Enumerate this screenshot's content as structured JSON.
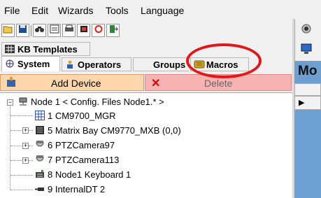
{
  "menu": [
    "File",
    "Edit",
    "Wizards",
    "Tools",
    "Language"
  ],
  "toolbar_icons": [
    "open-folder-icon",
    "save-icon",
    "find-icon",
    "properties-icon",
    "print-icon",
    "sync-icon",
    "refresh-icon",
    "exit-icon"
  ],
  "tabs": {
    "kb_templates": "KB Templates",
    "system": "System",
    "operators": "Operators",
    "groups": "Groups",
    "macros": "Macros"
  },
  "actions": {
    "add_device": "Add Device",
    "delete": "Delete"
  },
  "tree": {
    "root": "Node 1 < Config. Files Node1.* >",
    "items": [
      {
        "label": "1 CM9700_MGR",
        "icon": "grid-icon",
        "expandable": false
      },
      {
        "label": "5 Matrix Bay CM9770_MXB (0,0)",
        "icon": "matrix-icon",
        "expandable": true
      },
      {
        "label": "6 PTZCamera97",
        "icon": "dome-camera-icon",
        "expandable": true
      },
      {
        "label": "7 PTZCamera113",
        "icon": "dome-camera-icon",
        "expandable": true
      },
      {
        "label": "8 Node1 Keyboard 1",
        "icon": "keyboard-icon",
        "expandable": false
      },
      {
        "label": "9 InternalDT 2",
        "icon": "plug-icon",
        "expandable": false
      }
    ]
  },
  "right_panel": {
    "label": "Mo"
  },
  "colors": {
    "add_button": "#fdd6ab",
    "delete_button": "#f7b2b2",
    "highlight_oval": "#e01818",
    "panel_blue": "#6d9fd1"
  }
}
